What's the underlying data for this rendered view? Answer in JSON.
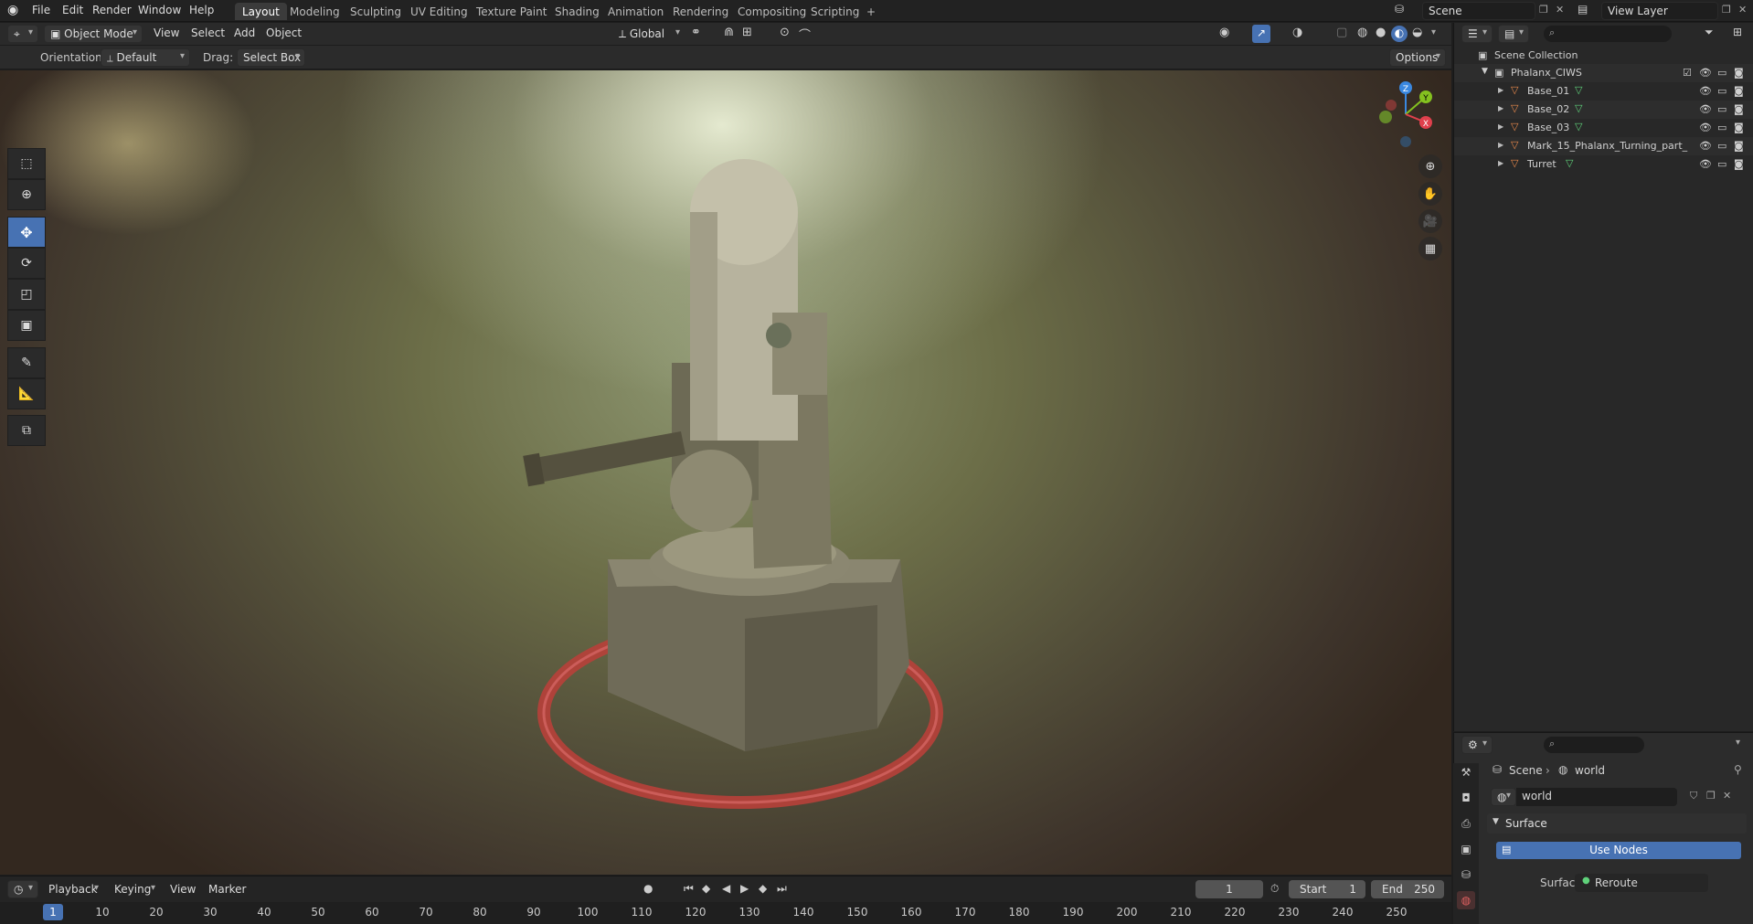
{
  "topbar": {
    "menus": [
      "File",
      "Edit",
      "Render",
      "Window",
      "Help"
    ],
    "workspaces": [
      "Layout",
      "Modeling",
      "Sculpting",
      "UV Editing",
      "Texture Paint",
      "Shading",
      "Animation",
      "Rendering",
      "Compositing",
      "Scripting"
    ],
    "active_workspace": "Layout",
    "add_tab": "+",
    "scene": "Scene",
    "view_layer": "View Layer"
  },
  "viewport_header": {
    "mode": "Object Mode",
    "menus": [
      "View",
      "Select",
      "Add",
      "Object"
    ],
    "transform_orientation": "Global"
  },
  "tool_settings": {
    "orientation_label": "Orientation:",
    "orientation_value": "Default",
    "drag_label": "Drag:",
    "drag_value": "Select Box",
    "options": "Options"
  },
  "gizmo": {
    "x": "X",
    "y": "Y",
    "z": "Z"
  },
  "outliner": {
    "root": "Scene Collection",
    "collection": "Phalanx_CIWS",
    "objects": [
      "Base_01",
      "Base_02",
      "Base_03",
      "Mark_15_Phalanx_Turning_part_",
      "Turret"
    ]
  },
  "properties": {
    "breadcrumb_scene": "Scene",
    "breadcrumb_world": "world",
    "world_name": "world",
    "panel_title": "Surface",
    "use_nodes": "Use Nodes",
    "surface_label": "Surface",
    "surface_value": "Reroute"
  },
  "timeline": {
    "menus": [
      "Playback",
      "Keying",
      "View",
      "Marker"
    ],
    "current_frame": "1",
    "start_label": "Start",
    "start_value": "1",
    "end_label": "End",
    "end_value": "250",
    "ruler": [
      "1",
      "10",
      "20",
      "30",
      "40",
      "50",
      "60",
      "70",
      "80",
      "90",
      "100",
      "110",
      "120",
      "130",
      "140",
      "150",
      "160",
      "170",
      "180",
      "190",
      "200",
      "210",
      "220",
      "230",
      "240",
      "250"
    ]
  },
  "colors": {
    "accent": "#4772b3",
    "axis_x": "#e0404c",
    "axis_y": "#84c11f",
    "axis_z": "#3a88e0",
    "mesh_icon": "#e8894b",
    "selection_ring": "#c0403a"
  }
}
